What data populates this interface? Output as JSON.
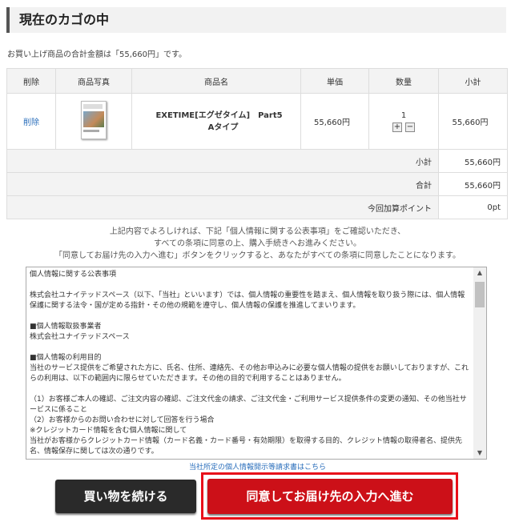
{
  "heading": "現在のカゴの中",
  "total_note": "お買い上げ商品の合計金額は「55,660円」です。",
  "table": {
    "headers": [
      "削除",
      "商品写真",
      "商品名",
      "単価",
      "数量",
      "小計"
    ],
    "item": {
      "delete": "削除",
      "name_line1": "EXETIME[エグゼタイム]　Part5",
      "name_line2": "Aタイプ",
      "price": "55,660円",
      "qty": "1",
      "plus": "+",
      "minus": "−",
      "subtotal": "55,660円"
    },
    "summary": [
      {
        "label": "小計",
        "value": "55,660円"
      },
      {
        "label": "合計",
        "value": "55,660円"
      },
      {
        "label": "今回加算ポイント",
        "value": "0pt"
      }
    ]
  },
  "instructions": [
    "上記内容でよろしければ、下記「個人情報に関する公表事項」をご確認いただき、",
    "すべての条項に同意の上、購入手続きへお進みください。",
    "「同意してお届け先の入力へ進む」ボタンをクリックすると、あなたがすべての条項に同意したことになります。"
  ],
  "policy": [
    "個人情報に関する公表事項",
    "株式会社ユナイテッドスペース（以下、「当社」といいます）では、個人情報の重要性を踏まえ、個人情報を取り扱う際には、個人情報保護に関する法令・国が定める指針・その他の規範を遵守し、個人情報の保護を推進してまいります。",
    "■個人情報取扱事業者\n株式会社ユナイテッドスペース",
    "■個人情報の利用目的\n当社のサービス提供をご希望された方に、氏名、住所、連絡先、その他お申込みに必要な個人情報の提供をお願いしておりますが、これらの利用は、以下の範囲内に限らせていただきます。その他の目的で利用することはありません。",
    "（1）お客様ご本人の確認、ご注文内容の確認、ご注文代金の請求、ご注文代金・ご利用サービス提供条件の変更の通知、その他当社サービスに係ること\n（2）お客様からのお問い合わせに対して回答を行う場合\n※クレジットカード情報を含む個人情報に関して\n当社がお客様からクレジットカード情報（カード名義・カード番号・有効期限）を取得する目的、クレジット情報の取得者名、提供先名、情報保存に関しては次の通りです。"
  ],
  "disclosure_link": "当社所定の個人情報開示等請求書はこちら",
  "buttons": {
    "continue": "買い物を続ける",
    "agree": "同意してお届け先の入力へ進む"
  }
}
